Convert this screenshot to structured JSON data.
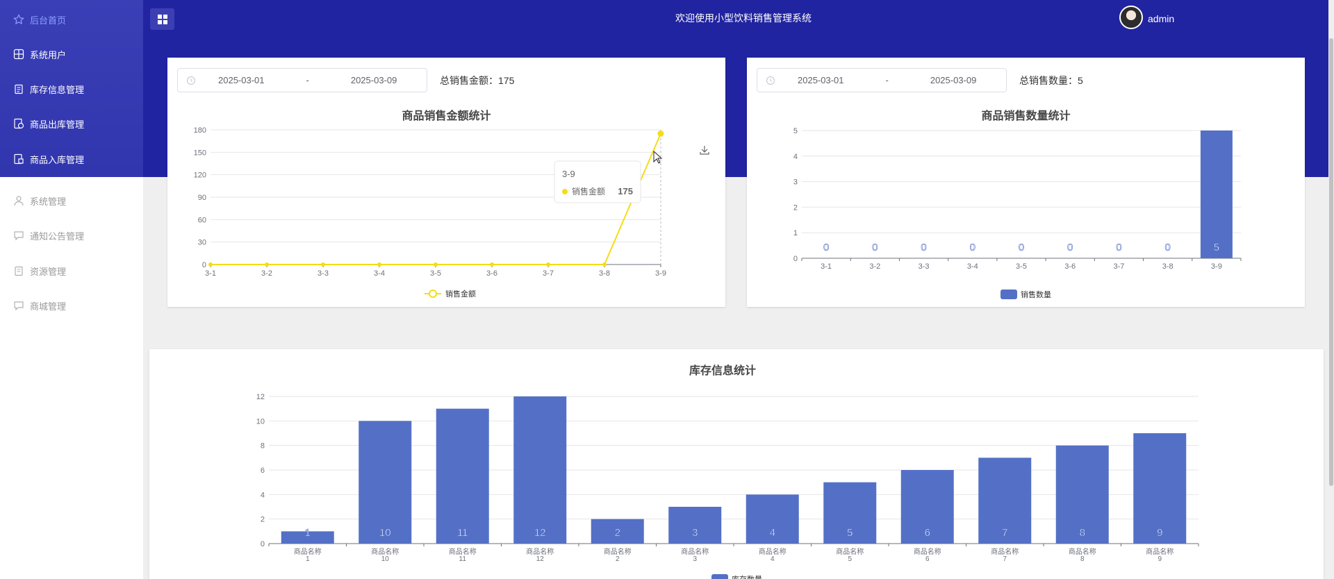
{
  "sidebar": {
    "items": [
      {
        "label": "后台首页"
      },
      {
        "label": "系统用户"
      },
      {
        "label": "库存信息管理"
      },
      {
        "label": "商品出库管理"
      },
      {
        "label": "商品入库管理"
      },
      {
        "label": "系统管理"
      },
      {
        "label": "通知公告管理"
      },
      {
        "label": "资源管理"
      },
      {
        "label": "商城管理"
      }
    ]
  },
  "header": {
    "title": "欢迎使用小型饮料销售管理系统",
    "user": "admin"
  },
  "sales_amount": {
    "start_date": "2025-03-01",
    "separator": "-",
    "end_date": "2025-03-09",
    "total_label": "总销售金额：",
    "total_value": "175"
  },
  "sales_qty": {
    "start_date": "2025-03-01",
    "separator": "-",
    "end_date": "2025-03-09",
    "total_label": "总销售数量：",
    "total_value": "5"
  },
  "tooltip": {
    "title": "3-9",
    "series": "销售金额",
    "value": "175"
  },
  "colors": {
    "accent": "#2124a0",
    "bar": "#5470c6",
    "line": "#f5dc14"
  },
  "chart_data": [
    {
      "type": "line",
      "title": "商品销售金额统计",
      "x": [
        "3-1",
        "3-2",
        "3-3",
        "3-4",
        "3-5",
        "3-6",
        "3-7",
        "3-8",
        "3-9"
      ],
      "series": [
        {
          "name": "销售金额",
          "values": [
            0,
            0,
            0,
            0,
            0,
            0,
            0,
            0,
            175
          ]
        }
      ],
      "yticks": [
        0,
        30,
        60,
        90,
        120,
        150,
        180
      ],
      "ylim": [
        0,
        180
      ],
      "legend": "bottom"
    },
    {
      "type": "bar",
      "title": "商品销售数量统计",
      "categories": [
        "3-1",
        "3-2",
        "3-3",
        "3-4",
        "3-5",
        "3-6",
        "3-7",
        "3-8",
        "3-9"
      ],
      "series": [
        {
          "name": "销售数量",
          "values": [
            0,
            0,
            0,
            0,
            0,
            0,
            0,
            0,
            5
          ]
        }
      ],
      "yticks": [
        0,
        1,
        2,
        3,
        4,
        5
      ],
      "ylim": [
        0,
        5
      ],
      "legend": "bottom"
    },
    {
      "type": "bar",
      "title": "库存信息统计",
      "categories": [
        "商品名称\n1",
        "商品名称\n10",
        "商品名称\n11",
        "商品名称\n12",
        "商品名称\n2",
        "商品名称\n3",
        "商品名称\n4",
        "商品名称\n5",
        "商品名称\n6",
        "商品名称\n7",
        "商品名称\n8",
        "商品名称\n9"
      ],
      "series": [
        {
          "name": "库存数量",
          "values": [
            1,
            10,
            11,
            12,
            2,
            3,
            4,
            5,
            6,
            7,
            8,
            9
          ]
        }
      ],
      "yticks": [
        0,
        2,
        4,
        6,
        8,
        10,
        12
      ],
      "ylim": [
        0,
        12
      ],
      "legend": "bottom"
    }
  ]
}
